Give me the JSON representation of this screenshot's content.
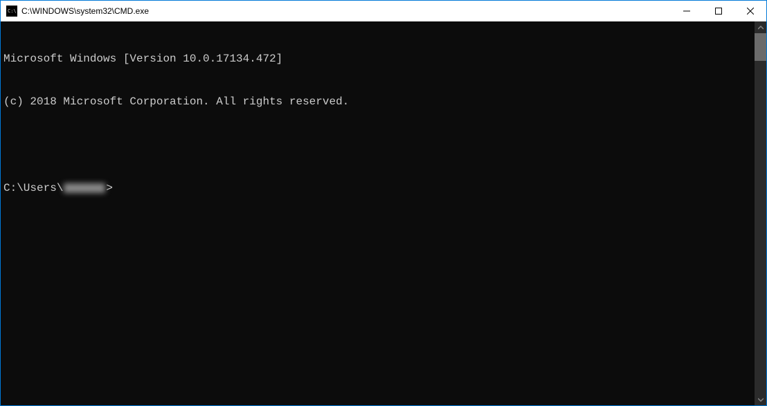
{
  "titlebar": {
    "title": "C:\\WINDOWS\\system32\\CMD.exe"
  },
  "terminal": {
    "line1": "Microsoft Windows [Version 10.0.17134.472]",
    "line2": "(c) 2018 Microsoft Corporation. All rights reserved.",
    "prompt_prefix": "C:\\Users\\",
    "prompt_suffix": ">"
  }
}
